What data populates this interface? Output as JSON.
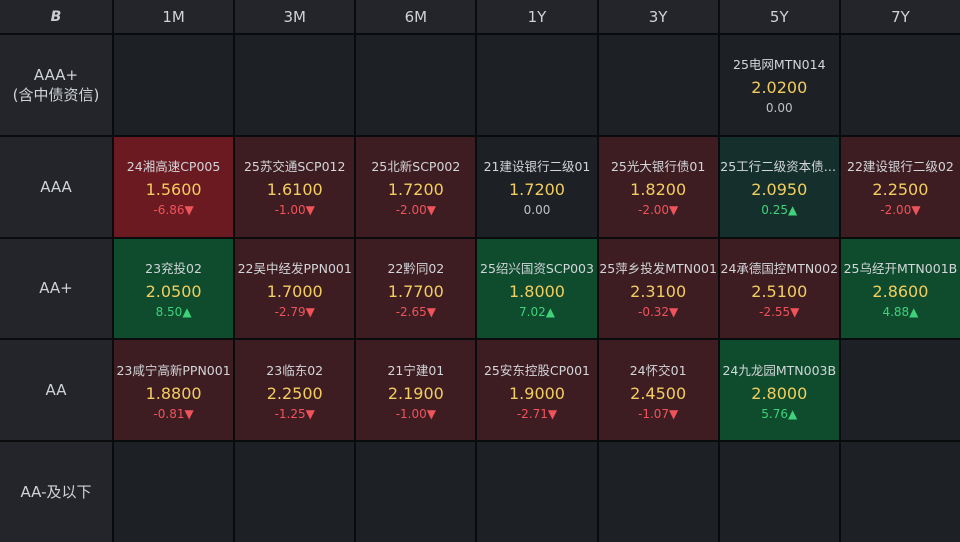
{
  "corner_label": "B",
  "columns": [
    "1M",
    "3M",
    "6M",
    "1Y",
    "3Y",
    "5Y",
    "7Y"
  ],
  "rows": [
    {
      "label": "AAA+\n(含中债资信)",
      "cells": [
        null,
        null,
        null,
        null,
        null,
        {
          "name": "25电网MTN014",
          "rate": "2.0200",
          "change": "0.00",
          "dir": "flat",
          "tone": "neutral"
        },
        null
      ]
    },
    {
      "label": "AAA",
      "cells": [
        {
          "name": "24湘高速CP005",
          "rate": "1.5600",
          "change": "-6.86▼",
          "dir": "down",
          "tone": "deepred"
        },
        {
          "name": "25苏交通SCP012",
          "rate": "1.6100",
          "change": "-1.00▼",
          "dir": "down",
          "tone": "red"
        },
        {
          "name": "25北新SCP002",
          "rate": "1.7200",
          "change": "-2.00▼",
          "dir": "down",
          "tone": "red"
        },
        {
          "name": "21建设银行二级01",
          "rate": "1.7200",
          "change": "0.00",
          "dir": "flat",
          "tone": "neutral"
        },
        {
          "name": "25光大银行债01",
          "rate": "1.8200",
          "change": "-2.00▼",
          "dir": "down",
          "tone": "red"
        },
        {
          "name": "25工行二级资本债0...",
          "rate": "2.0950",
          "change": "0.25▲",
          "dir": "up",
          "tone": "teal"
        },
        {
          "name": "22建设银行二级02",
          "rate": "2.2500",
          "change": "-2.00▼",
          "dir": "down",
          "tone": "red"
        }
      ]
    },
    {
      "label": "AA+",
      "cells": [
        {
          "name": "23兖投02",
          "rate": "2.0500",
          "change": "8.50▲",
          "dir": "up",
          "tone": "green"
        },
        {
          "name": "22吴中经发PPN001",
          "rate": "1.7000",
          "change": "-2.79▼",
          "dir": "down",
          "tone": "red"
        },
        {
          "name": "22黔同02",
          "rate": "1.7700",
          "change": "-2.65▼",
          "dir": "down",
          "tone": "red"
        },
        {
          "name": "25绍兴国资SCP003",
          "rate": "1.8000",
          "change": "7.02▲",
          "dir": "up",
          "tone": "green"
        },
        {
          "name": "25萍乡投发MTN001",
          "rate": "2.3100",
          "change": "-0.32▼",
          "dir": "down",
          "tone": "red"
        },
        {
          "name": "24承德国控MTN002",
          "rate": "2.5100",
          "change": "-2.55▼",
          "dir": "down",
          "tone": "red"
        },
        {
          "name": "25乌经开MTN001B",
          "rate": "2.8600",
          "change": "4.88▲",
          "dir": "up",
          "tone": "green"
        }
      ]
    },
    {
      "label": "AA",
      "cells": [
        {
          "name": "23咸宁高新PPN001",
          "rate": "1.8800",
          "change": "-0.81▼",
          "dir": "down",
          "tone": "red"
        },
        {
          "name": "23临东02",
          "rate": "2.2500",
          "change": "-1.25▼",
          "dir": "down",
          "tone": "red"
        },
        {
          "name": "21宁建01",
          "rate": "2.1900",
          "change": "-1.00▼",
          "dir": "down",
          "tone": "red"
        },
        {
          "name": "25安东控股CP001",
          "rate": "1.9000",
          "change": "-2.71▼",
          "dir": "down",
          "tone": "red"
        },
        {
          "name": "24怀交01",
          "rate": "2.4500",
          "change": "-1.07▼",
          "dir": "down",
          "tone": "red"
        },
        {
          "name": "24九龙园MTN003B",
          "rate": "2.8000",
          "change": "5.76▲",
          "dir": "up",
          "tone": "green"
        },
        null
      ]
    },
    {
      "label": "AA-及以下",
      "cells": [
        null,
        null,
        null,
        null,
        null,
        null,
        null
      ]
    }
  ],
  "colors": {
    "up": "#3fd27a",
    "down": "#f0535a",
    "rate": "#f3cd5e",
    "header_bg": "#23252a",
    "cell_bg": "#1d2025"
  }
}
